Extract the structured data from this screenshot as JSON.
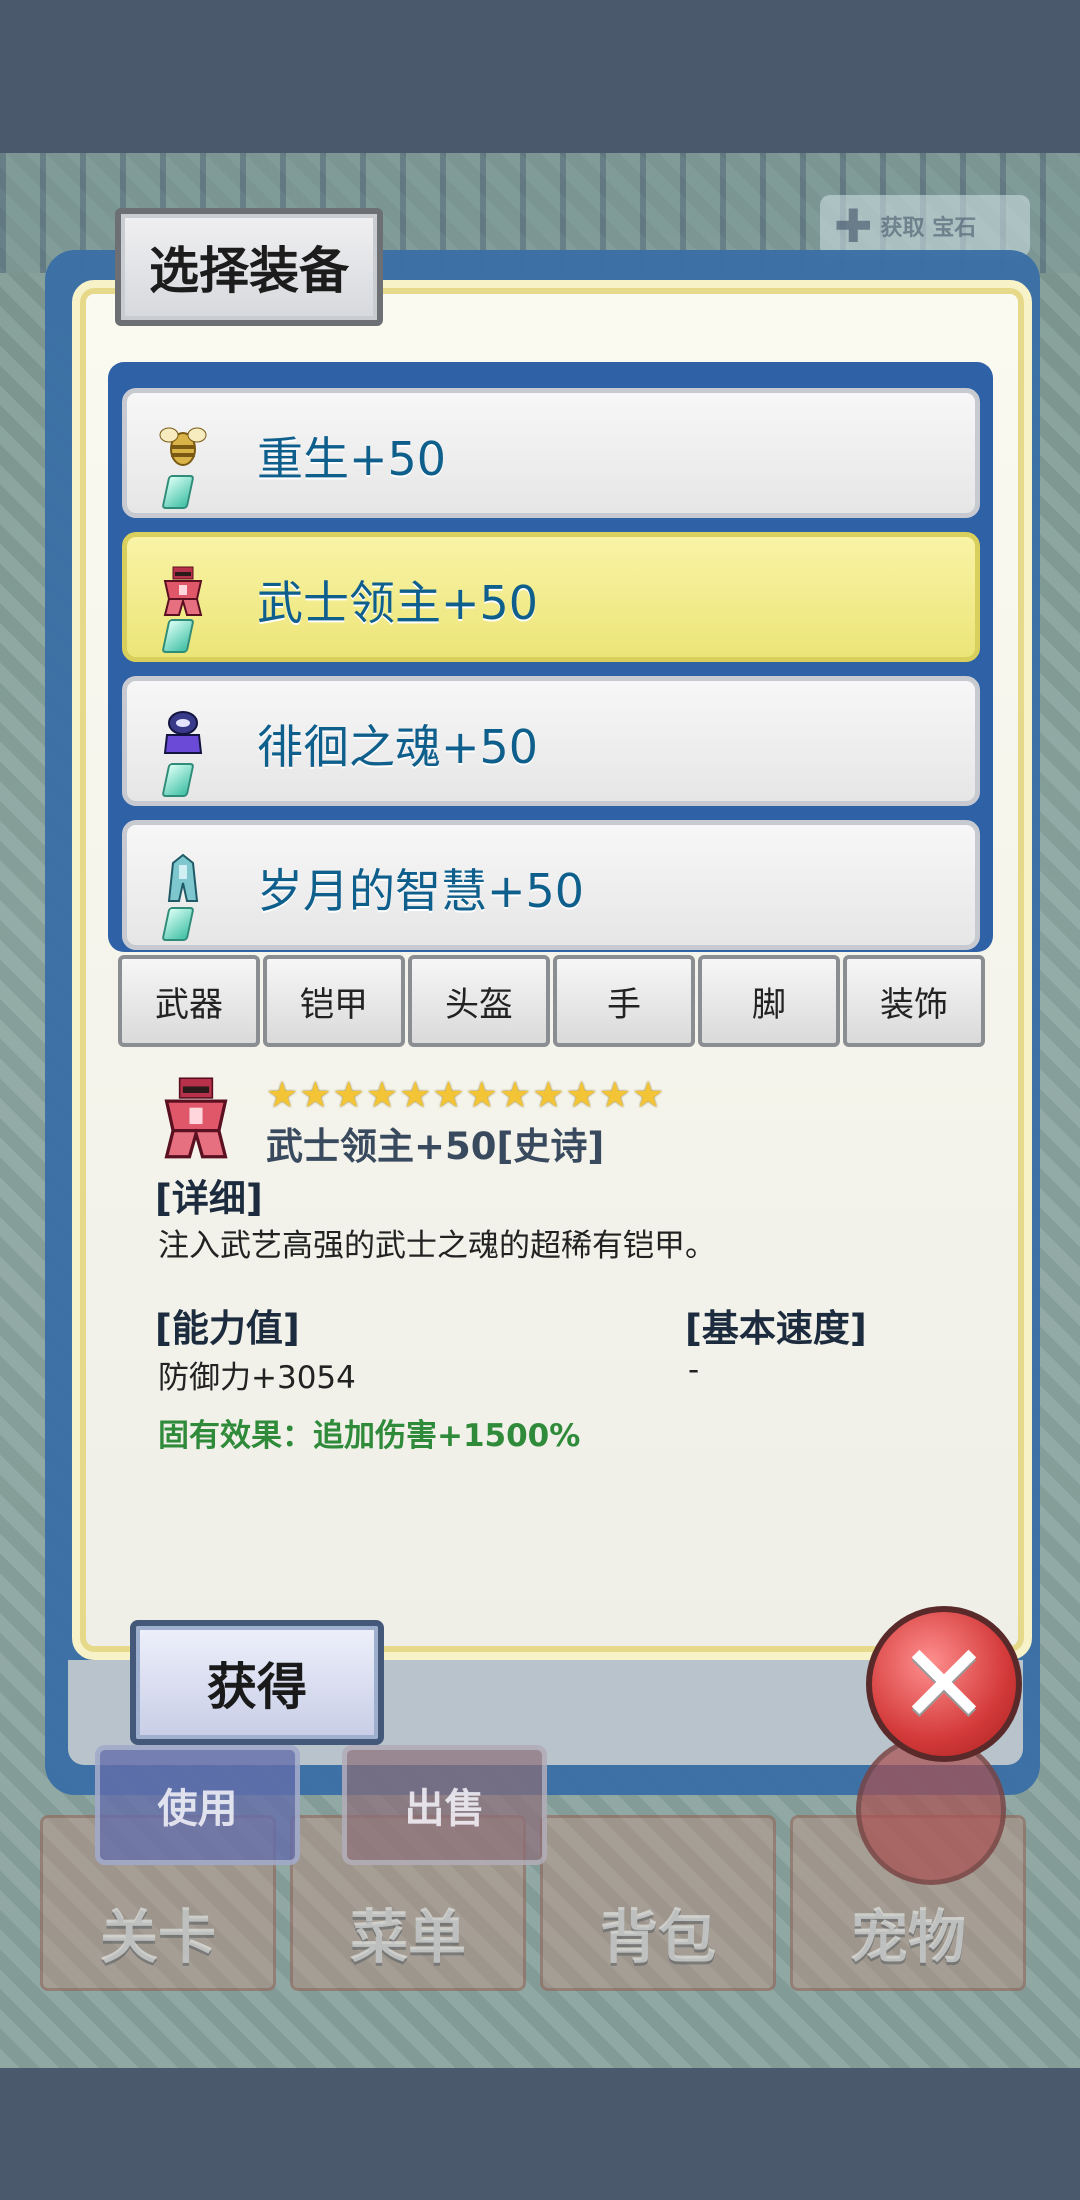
{
  "dialog": {
    "title": "选择装备",
    "items": [
      {
        "name": "重生+50",
        "icon": "golden-bee-icon",
        "selected": false
      },
      {
        "name": "武士领主+50",
        "icon": "red-samurai-armor-icon",
        "selected": true
      },
      {
        "name": "徘徊之魂+50",
        "icon": "purple-spirit-icon",
        "selected": false
      },
      {
        "name": "岁月的智慧+50",
        "icon": "teal-robe-icon",
        "selected": false
      }
    ],
    "tabs": [
      "武器",
      "铠甲",
      "头盔",
      "手",
      "脚",
      "装饰"
    ],
    "detail": {
      "stars": "★★★★★★★★★★★★",
      "star_count": 12,
      "title": "武士领主+50[史诗]",
      "detail_label": "[详细]",
      "description": "注入武艺高强的武士之魂的超稀有铠甲。",
      "ability_label": "[能力值]",
      "ability_value": "防御力+3054",
      "speed_label": "[基本速度]",
      "speed_value": "-",
      "effect": "固有效果：追加伤害+1500%"
    },
    "obtain_label": "获得"
  },
  "background": {
    "use_label": "使用",
    "sell_label": "出售",
    "nav": [
      "关卡",
      "菜单",
      "背包",
      "宠物"
    ],
    "badge_label": "获取\n宝石"
  },
  "colors": {
    "dialog_frame": "#3a6fa6",
    "selected_item": "#f3ed8e",
    "item_text": "#0f5f8c",
    "effect_text": "#2f8a3a",
    "close_button": "#d43a3a"
  }
}
